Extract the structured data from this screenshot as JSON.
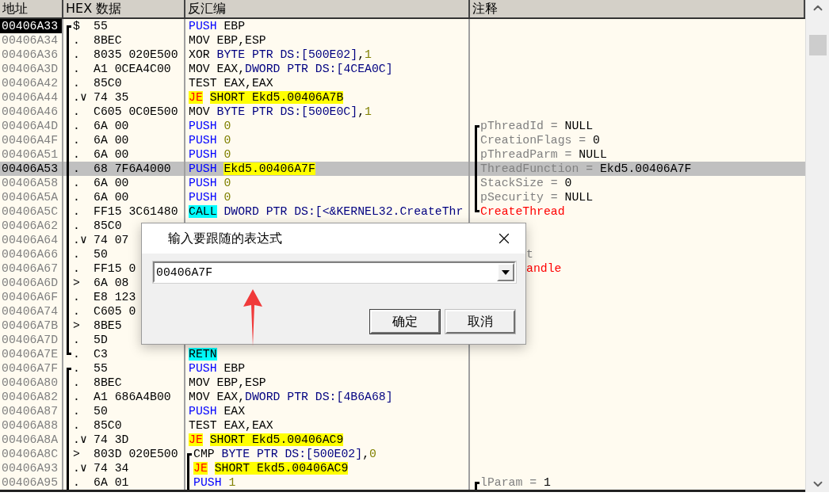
{
  "columns": [
    {
      "label": "地址"
    },
    {
      "label": "HEX 数据"
    },
    {
      "label": "反汇编"
    },
    {
      "label": "注释"
    }
  ],
  "rows": [
    {
      "address": "00406A33",
      "cursor": true,
      "selected": false,
      "flow": {
        "start": true,
        "end": false
      },
      "marker": "$",
      "hex": "55",
      "instruction": {
        "mnemonic": "PUSH",
        "kind": "push",
        "operands": [
          {
            "text": "EBP",
            "kind": "plain"
          }
        ]
      }
    },
    {
      "address": "00406A34",
      "cursor": false,
      "selected": false,
      "flow": {
        "start": false,
        "end": false
      },
      "marker": ".",
      "hex": "8BEC",
      "instruction": {
        "mnemonic": "MOV",
        "kind": "plain",
        "operands": [
          {
            "text": "EBP,ESP",
            "kind": "plain"
          }
        ]
      }
    },
    {
      "address": "00406A36",
      "cursor": false,
      "selected": false,
      "flow": {
        "start": false,
        "end": false
      },
      "marker": ".",
      "hex": "8035 020E500",
      "instruction": {
        "mnemonic": "XOR",
        "kind": "plain",
        "operands": [
          {
            "text": "BYTE PTR DS:[500E02]",
            "kind": "ptr"
          },
          {
            "text": ",",
            "kind": "plain"
          },
          {
            "text": "1",
            "kind": "num"
          }
        ]
      }
    },
    {
      "address": "00406A3D",
      "cursor": false,
      "selected": false,
      "flow": {
        "start": false,
        "end": false
      },
      "marker": ".",
      "hex": "A1 0CEA4C00",
      "instruction": {
        "mnemonic": "MOV",
        "kind": "plain",
        "operands": [
          {
            "text": "EAX,",
            "kind": "plain"
          },
          {
            "text": "DWORD PTR DS:[4CEA0C]",
            "kind": "ptr"
          }
        ]
      }
    },
    {
      "address": "00406A42",
      "cursor": false,
      "selected": false,
      "flow": {
        "start": false,
        "end": false
      },
      "marker": ".",
      "hex": "85C0",
      "instruction": {
        "mnemonic": "TEST",
        "kind": "plain",
        "operands": [
          {
            "text": "EAX,EAX",
            "kind": "plain"
          }
        ]
      }
    },
    {
      "address": "00406A44",
      "cursor": false,
      "selected": false,
      "flow": {
        "start": false,
        "end": false
      },
      "marker": ".∨",
      "hex": "74 35",
      "instruction": {
        "mnemonic": "JE",
        "kind": "jump",
        "operands": [
          {
            "text": "SHORT Ekd5.00406A7B",
            "kind": "target"
          }
        ]
      }
    },
    {
      "address": "00406A46",
      "cursor": false,
      "selected": false,
      "flow": {
        "start": false,
        "end": false
      },
      "marker": ".",
      "hex": "C605 0C0E500",
      "instruction": {
        "mnemonic": "MOV",
        "kind": "plain",
        "operands": [
          {
            "text": "BYTE PTR DS:[500E0C]",
            "kind": "ptr"
          },
          {
            "text": ",",
            "kind": "plain"
          },
          {
            "text": "1",
            "kind": "num"
          }
        ]
      }
    },
    {
      "address": "00406A4D",
      "cursor": false,
      "selected": false,
      "flow": {
        "start": false,
        "end": false
      },
      "marker": ".",
      "hex": "6A 00",
      "instruction": {
        "mnemonic": "PUSH",
        "kind": "push",
        "operands": [
          {
            "text": "0",
            "kind": "num"
          }
        ]
      },
      "comment": {
        "kind": "arg",
        "covered": false,
        "name": "pThreadId = ",
        "value": "NULL"
      },
      "comment_flow": {
        "start": true,
        "end": false
      }
    },
    {
      "address": "00406A4F",
      "cursor": false,
      "selected": false,
      "flow": {
        "start": false,
        "end": false
      },
      "marker": ".",
      "hex": "6A 00",
      "instruction": {
        "mnemonic": "PUSH",
        "kind": "push",
        "operands": [
          {
            "text": "0",
            "kind": "num"
          }
        ]
      },
      "comment": {
        "kind": "arg",
        "covered": false,
        "name": "CreationFlags = ",
        "value": "0"
      },
      "comment_flow": {
        "start": false,
        "end": false
      }
    },
    {
      "address": "00406A51",
      "cursor": false,
      "selected": false,
      "flow": {
        "start": false,
        "end": false
      },
      "marker": ".",
      "hex": "6A 00",
      "instruction": {
        "mnemonic": "PUSH",
        "kind": "push",
        "operands": [
          {
            "text": "0",
            "kind": "num"
          }
        ]
      },
      "comment": {
        "kind": "arg",
        "covered": false,
        "name": "pThreadParm = ",
        "value": "NULL"
      },
      "comment_flow": {
        "start": false,
        "end": false
      }
    },
    {
      "address": "00406A53",
      "cursor": false,
      "selected": true,
      "flow": {
        "start": false,
        "end": false
      },
      "marker": ".",
      "hex": "68 7F6A4000",
      "instruction": {
        "mnemonic": "PUSH",
        "kind": "push",
        "operands": [
          {
            "text": "Ekd5.00406A7F",
            "kind": "target"
          }
        ]
      },
      "comment": {
        "kind": "arg",
        "covered": false,
        "name": "ThreadFunction = ",
        "value": "Ekd5.00406A7F"
      },
      "comment_flow": {
        "start": false,
        "end": false
      }
    },
    {
      "address": "00406A58",
      "cursor": false,
      "selected": false,
      "flow": {
        "start": false,
        "end": false
      },
      "marker": ".",
      "hex": "6A 00",
      "instruction": {
        "mnemonic": "PUSH",
        "kind": "push",
        "operands": [
          {
            "text": "0",
            "kind": "num"
          }
        ]
      },
      "comment": {
        "kind": "arg",
        "covered": false,
        "name": "StackSize = ",
        "value": "0"
      },
      "comment_flow": {
        "start": false,
        "end": false
      }
    },
    {
      "address": "00406A5A",
      "cursor": false,
      "selected": false,
      "flow": {
        "start": false,
        "end": false
      },
      "marker": ".",
      "hex": "6A 00",
      "instruction": {
        "mnemonic": "PUSH",
        "kind": "push",
        "operands": [
          {
            "text": "0",
            "kind": "num"
          }
        ]
      },
      "comment": {
        "kind": "arg",
        "covered": false,
        "name": "pSecurity = ",
        "value": "NULL"
      },
      "comment_flow": {
        "start": false,
        "end": false
      }
    },
    {
      "address": "00406A5C",
      "cursor": false,
      "selected": false,
      "flow": {
        "start": false,
        "end": false
      },
      "marker": ".",
      "hex": "FF15 3C61480",
      "instruction": {
        "mnemonic": "CALL",
        "kind": "call",
        "operands": [
          {
            "text": "DWORD PTR DS:[<&KERNEL32.CreateThr",
            "kind": "ptr"
          }
        ]
      },
      "comment": {
        "kind": "func",
        "covered": false,
        "name": "CreateThread"
      },
      "comment_flow": {
        "start": false,
        "end": true
      }
    },
    {
      "address": "00406A62",
      "cursor": false,
      "selected": false,
      "flow": {
        "start": false,
        "end": false
      },
      "marker": ".",
      "hex": "85C0"
    },
    {
      "address": "00406A64",
      "cursor": false,
      "selected": false,
      "flow": {
        "start": false,
        "end": false
      },
      "marker": ".∨",
      "hex": "74 07"
    },
    {
      "address": "00406A66",
      "cursor": false,
      "selected": false,
      "flow": {
        "start": false,
        "end": false
      },
      "marker": ".",
      "hex": "50",
      "comment": {
        "kind": "arg",
        "covered": true,
        "name": "t"
      }
    },
    {
      "address": "00406A67",
      "cursor": false,
      "selected": false,
      "flow": {
        "start": false,
        "end": false
      },
      "marker": ".",
      "hex": "FF15 0",
      "comment": {
        "kind": "func",
        "covered": true,
        "name": "andle"
      }
    },
    {
      "address": "00406A6D",
      "cursor": false,
      "selected": false,
      "flow": {
        "start": false,
        "end": false
      },
      "marker": ">",
      "hex": "6A 08"
    },
    {
      "address": "00406A6F",
      "cursor": false,
      "selected": false,
      "flow": {
        "start": false,
        "end": false
      },
      "marker": ".",
      "hex": "E8 123"
    },
    {
      "address": "00406A74",
      "cursor": false,
      "selected": false,
      "flow": {
        "start": false,
        "end": false
      },
      "marker": ".",
      "hex": "C605 0"
    },
    {
      "address": "00406A7B",
      "cursor": false,
      "selected": false,
      "flow": {
        "start": false,
        "end": false
      },
      "marker": ">",
      "hex": "8BE5"
    },
    {
      "address": "00406A7D",
      "cursor": false,
      "selected": false,
      "flow": {
        "start": false,
        "end": false
      },
      "marker": ".",
      "hex": "5D"
    },
    {
      "address": "00406A7E",
      "cursor": false,
      "selected": false,
      "flow": {
        "start": false,
        "end": true
      },
      "marker": ".",
      "hex": "C3",
      "instruction": {
        "mnemonic": "RETN",
        "kind": "ret"
      }
    },
    {
      "address": "00406A7F",
      "cursor": false,
      "selected": false,
      "flow": {
        "start": true,
        "end": false
      },
      "marker": ".",
      "hex": "55",
      "instruction": {
        "mnemonic": "PUSH",
        "kind": "push",
        "operands": [
          {
            "text": "EBP",
            "kind": "plain"
          }
        ]
      }
    },
    {
      "address": "00406A80",
      "cursor": false,
      "selected": false,
      "flow": {
        "start": false,
        "end": false
      },
      "marker": ".",
      "hex": "8BEC",
      "instruction": {
        "mnemonic": "MOV",
        "kind": "plain",
        "operands": [
          {
            "text": "EBP,ESP",
            "kind": "plain"
          }
        ]
      }
    },
    {
      "address": "00406A82",
      "cursor": false,
      "selected": false,
      "flow": {
        "start": false,
        "end": false
      },
      "marker": ".",
      "hex": "A1 686A4B00",
      "instruction": {
        "mnemonic": "MOV",
        "kind": "plain",
        "operands": [
          {
            "text": "EAX,",
            "kind": "plain"
          },
          {
            "text": "DWORD PTR DS:[4B6A68]",
            "kind": "ptr"
          }
        ]
      }
    },
    {
      "address": "00406A87",
      "cursor": false,
      "selected": false,
      "flow": {
        "start": false,
        "end": false
      },
      "marker": ".",
      "hex": "50",
      "instruction": {
        "mnemonic": "PUSH",
        "kind": "push",
        "operands": [
          {
            "text": "EAX",
            "kind": "plain"
          }
        ]
      }
    },
    {
      "address": "00406A88",
      "cursor": false,
      "selected": false,
      "flow": {
        "start": false,
        "end": false
      },
      "marker": ".",
      "hex": "85C0",
      "instruction": {
        "mnemonic": "TEST",
        "kind": "plain",
        "operands": [
          {
            "text": "EAX,EAX",
            "kind": "plain"
          }
        ]
      }
    },
    {
      "address": "00406A8A",
      "cursor": false,
      "selected": false,
      "flow": {
        "start": false,
        "end": false
      },
      "marker": ".∨",
      "hex": "74 3D",
      "instruction": {
        "mnemonic": "JE",
        "kind": "jump",
        "operands": [
          {
            "text": "SHORT Ekd5.00406AC9",
            "kind": "target"
          }
        ]
      }
    },
    {
      "address": "00406A8C",
      "cursor": false,
      "selected": false,
      "flow": {
        "start": false,
        "end": false
      },
      "marker": ">",
      "hex": "803D 020E500",
      "instruction": {
        "mnemonic": "CMP",
        "kind": "plain",
        "operands": [
          {
            "text": "BYTE PTR DS:[500E02]",
            "kind": "ptr"
          },
          {
            "text": ",",
            "kind": "plain"
          },
          {
            "text": "0",
            "kind": "num"
          }
        ]
      },
      "jump_flow": {
        "start": true,
        "end": false
      }
    },
    {
      "address": "00406A93",
      "cursor": false,
      "selected": false,
      "flow": {
        "start": false,
        "end": false
      },
      "marker": ".∨",
      "hex": "74 34",
      "instruction": {
        "mnemonic": "JE",
        "kind": "jump",
        "operands": [
          {
            "text": "SHORT Ekd5.00406AC9",
            "kind": "target"
          }
        ]
      },
      "jump_flow": {
        "start": false,
        "end": false
      }
    },
    {
      "address": "00406A95",
      "cursor": false,
      "selected": false,
      "flow": {
        "start": false,
        "end": false
      },
      "marker": ".",
      "hex": "6A 01",
      "instruction": {
        "mnemonic": "PUSH",
        "kind": "push",
        "operands": [
          {
            "text": "1",
            "kind": "num"
          }
        ]
      },
      "jump_flow": {
        "start": false,
        "end": false
      },
      "comment": {
        "kind": "arg",
        "covered": false,
        "name": "lParam = ",
        "value": "1"
      },
      "comment_flow": {
        "start": true,
        "end": false
      }
    }
  ],
  "dialog": {
    "title": "输入要跟随的表达式",
    "expression": {
      "value": "00406A7F"
    },
    "buttons": [
      {
        "label": "确定",
        "default": true
      },
      {
        "label": "取消",
        "default": false
      }
    ]
  }
}
